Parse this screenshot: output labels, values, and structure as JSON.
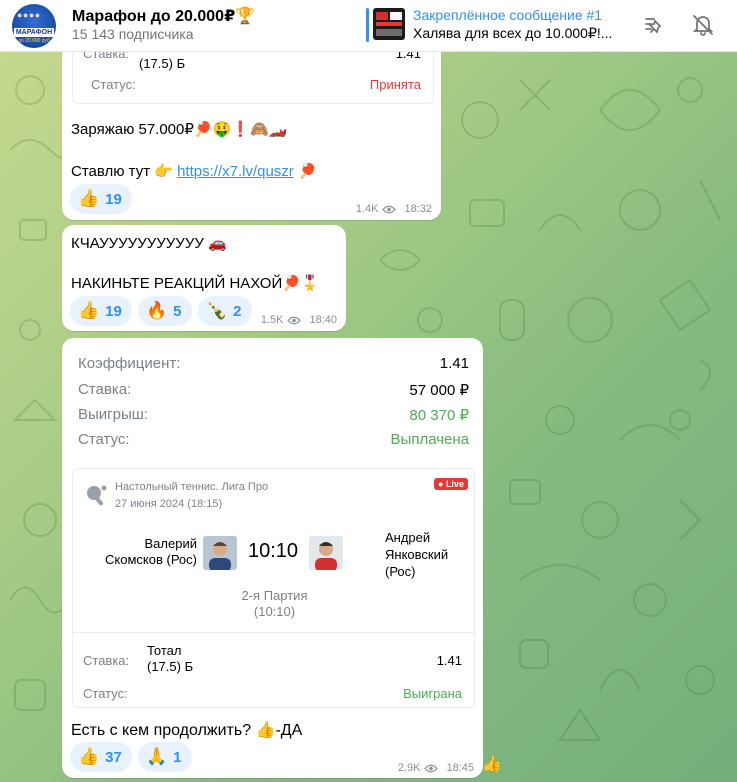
{
  "header": {
    "channel_title": "Марафон до 20.000₽🏆",
    "subscribers": "15 143 подписчика",
    "avatar": {
      "brand": "МАРАФОН",
      "sub": "до 20.000 руб"
    },
    "pinned_title": "Закреплённое сообщение #1",
    "pinned_text": "Халява для всех до 10.000₽!...",
    "icons": [
      "pin-list-icon",
      "mute-bell-icon"
    ]
  },
  "msg1": {
    "card_fragment": {
      "stake_label": "Ставка:",
      "stake_text": "(17.5) Б",
      "stake_value": "1.41",
      "status_label": "Статус:",
      "status_value": "Принята"
    },
    "line1": "Заряжаю 57.000₽🏓🤑❗🙈🏎️",
    "line2_prefix": "Ставлю тут 👉 ",
    "link": "https://x7.lv/quszr",
    "line2_suffix": " 🏓",
    "reactions": [
      {
        "emoji": "👍",
        "count": "19"
      }
    ],
    "views": "1.4K",
    "time": "18:32"
  },
  "msg2": {
    "line1": "КЧАУУУУУУУУУУУ 🚗",
    "line2": "НАКИНЬТЕ РЕАКЦИЙ НАХОЙ🏓🎖️",
    "reactions": [
      {
        "emoji": "👍",
        "count": "19"
      },
      {
        "emoji": "🔥",
        "count": "5"
      },
      {
        "emoji": "🍾",
        "count": "2"
      }
    ],
    "views": "1.5K",
    "time": "18:40"
  },
  "msg3": {
    "bet": {
      "coef_label": "Коэффициент:",
      "coef_value": "1.41",
      "stake_label": "Ставка:",
      "stake_value": "57 000 ₽",
      "win_label": "Выигрыш:",
      "win_value": "80 370 ₽",
      "status_label": "Статус:",
      "status_value": "Выплачена"
    },
    "match": {
      "league": "Настольный теннис. Лига Про",
      "date": "27 июня 2024 (18:15)",
      "live_badge": "Live",
      "player1_line1": "Валерий",
      "player1_line2": "Скомсков (Рос)",
      "score": "10:10",
      "player2_line1": "Андрей",
      "player2_line2": "Янковский",
      "player2_line3": "(Рос)",
      "period": "2-я Партия",
      "period_score": "(10:10)",
      "stake_label": "Ставка:",
      "stake_text_line1": "Тотал",
      "stake_text_line2": "(17.5) Б",
      "stake_value": "1.41",
      "status_label": "Статус:",
      "status_value": "Выиграна"
    },
    "text": "Есть с кем продолжить? 👍-ДА",
    "reactions": [
      {
        "emoji": "👍",
        "count": "37"
      },
      {
        "emoji": "🙏",
        "count": "1"
      }
    ],
    "views": "2.9K",
    "time": "18:45",
    "side_reaction": "👍"
  },
  "colors": {
    "accent": "#3390ec",
    "won": "#4caf50",
    "accepted": "#e53935",
    "live": "#e53935"
  }
}
